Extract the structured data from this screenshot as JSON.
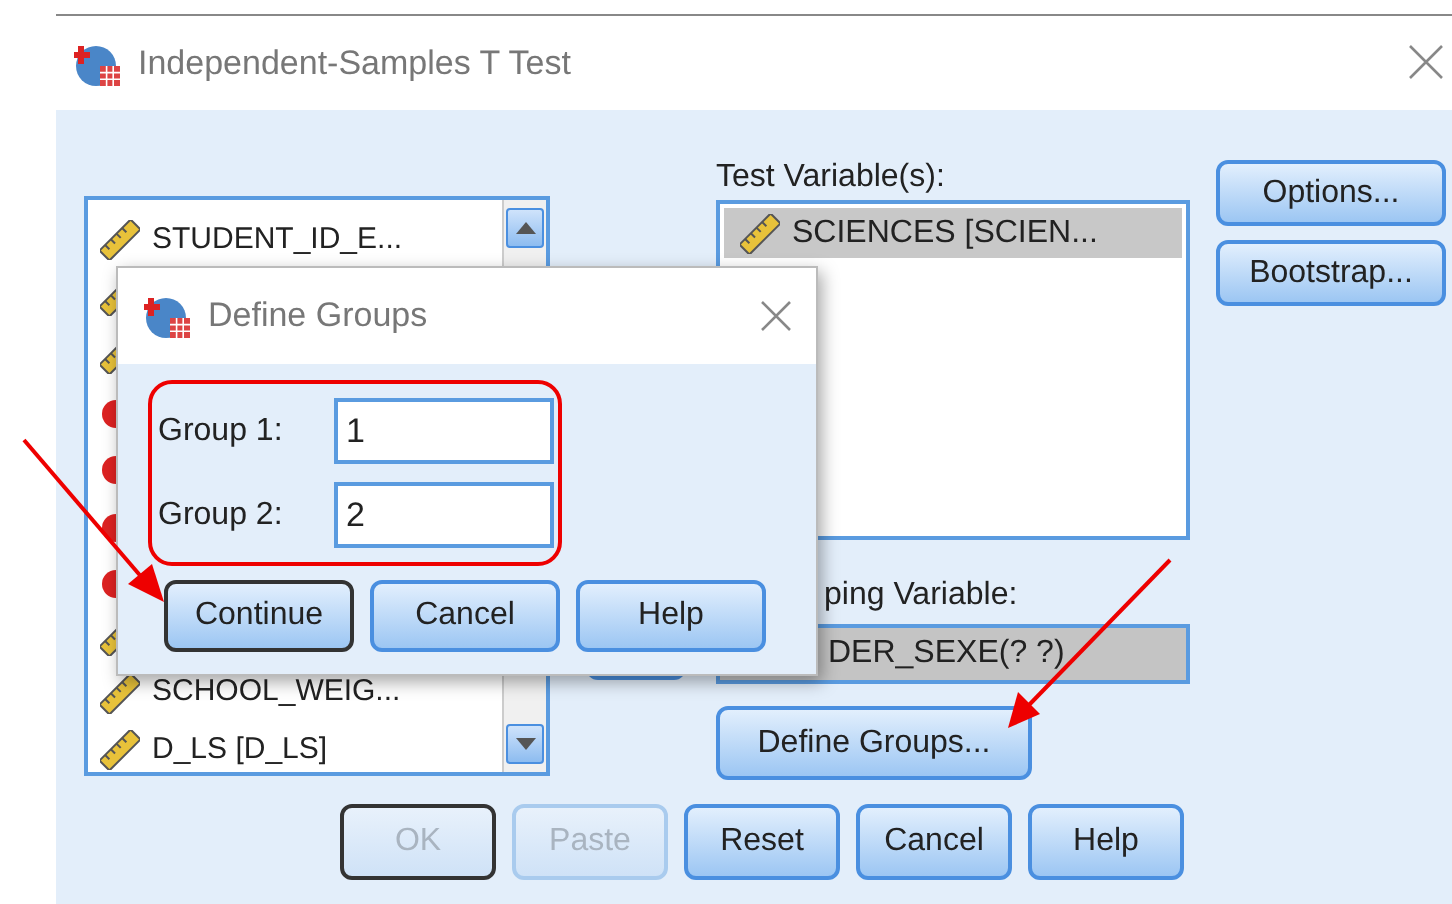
{
  "window": {
    "title": "Independent-Samples T Test"
  },
  "variables": [
    {
      "label": "STUDENT_ID_E...",
      "kind": "scale"
    },
    {
      "kind": "scale"
    },
    {
      "kind": "scale"
    },
    {
      "kind": "nominal"
    },
    {
      "kind": "nominal"
    },
    {
      "kind": "nominal"
    },
    {
      "kind": "nominal"
    },
    {
      "kind": "scale"
    },
    {
      "label": "SCHOOL_WEIG...",
      "kind": "scale"
    },
    {
      "label": "D_LS [D_LS]",
      "kind": "scale"
    }
  ],
  "test_variables": {
    "label": "Test Variable(s):",
    "items": [
      {
        "label": "SCIENCES [SCIEN...",
        "kind": "scale",
        "selected": true
      }
    ]
  },
  "grouping_variable": {
    "label": "ping Variable:",
    "value": "DER_SEXE(? ?)"
  },
  "define_groups_button": {
    "label": "Define Groups..."
  },
  "side_buttons": [
    {
      "label": "Options..."
    },
    {
      "label": "Bootstrap..."
    }
  ],
  "buttons": [
    {
      "label": "OK",
      "disabled": true,
      "focused": true
    },
    {
      "label": "Paste",
      "disabled": true,
      "focused": false
    },
    {
      "label": "Reset",
      "disabled": false,
      "focused": false
    },
    {
      "label": "Cancel",
      "disabled": false,
      "focused": false
    },
    {
      "label": "Help",
      "disabled": false,
      "focused": false
    }
  ],
  "dialog": {
    "title": "Define Groups",
    "fields": [
      {
        "label": "Group 1:",
        "value": "1"
      },
      {
        "label": "Group 2:",
        "value": "2"
      }
    ],
    "buttons": [
      {
        "label": "Continue",
        "focused": true
      },
      {
        "label": "Cancel",
        "focused": false
      },
      {
        "label": "Help",
        "focused": false
      }
    ]
  }
}
